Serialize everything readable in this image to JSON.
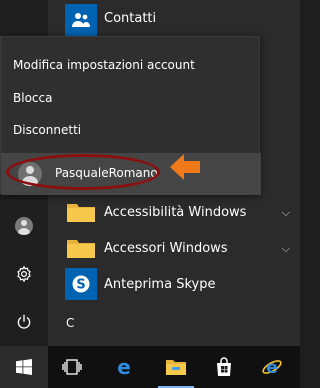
{
  "colors": {
    "accent": "#0063b1",
    "highlight_ellipse": "#8b0f0f",
    "arrow": "#f07a1a",
    "taskbar": "#101010",
    "menu_background": "#2b2b2b"
  },
  "account_menu": {
    "items": [
      {
        "label": "Modifica impostazioni account"
      },
      {
        "label": "Blocca"
      },
      {
        "label": "Disconnetti"
      }
    ],
    "user_name": "PasqualeRomano"
  },
  "apps": [
    {
      "label": "Contatti",
      "icon": "contacts-icon"
    },
    {
      "label": "Accessibilità Windows",
      "icon": "folder-icon",
      "expandable": true
    },
    {
      "label": "Accessori Windows",
      "icon": "folder-icon",
      "expandable": true
    },
    {
      "label": "Anteprima Skype",
      "icon": "skype-icon"
    }
  ],
  "section_letter": "C",
  "rail": [
    {
      "icon": "user-avatar-icon"
    },
    {
      "icon": "settings-gear-icon"
    },
    {
      "icon": "power-icon"
    }
  ],
  "taskbar": [
    {
      "icon": "windows-logo-icon"
    },
    {
      "icon": "task-view-icon"
    },
    {
      "icon": "edge-icon"
    },
    {
      "icon": "file-explorer-icon"
    },
    {
      "icon": "store-icon"
    },
    {
      "icon": "internet-explorer-icon"
    }
  ]
}
